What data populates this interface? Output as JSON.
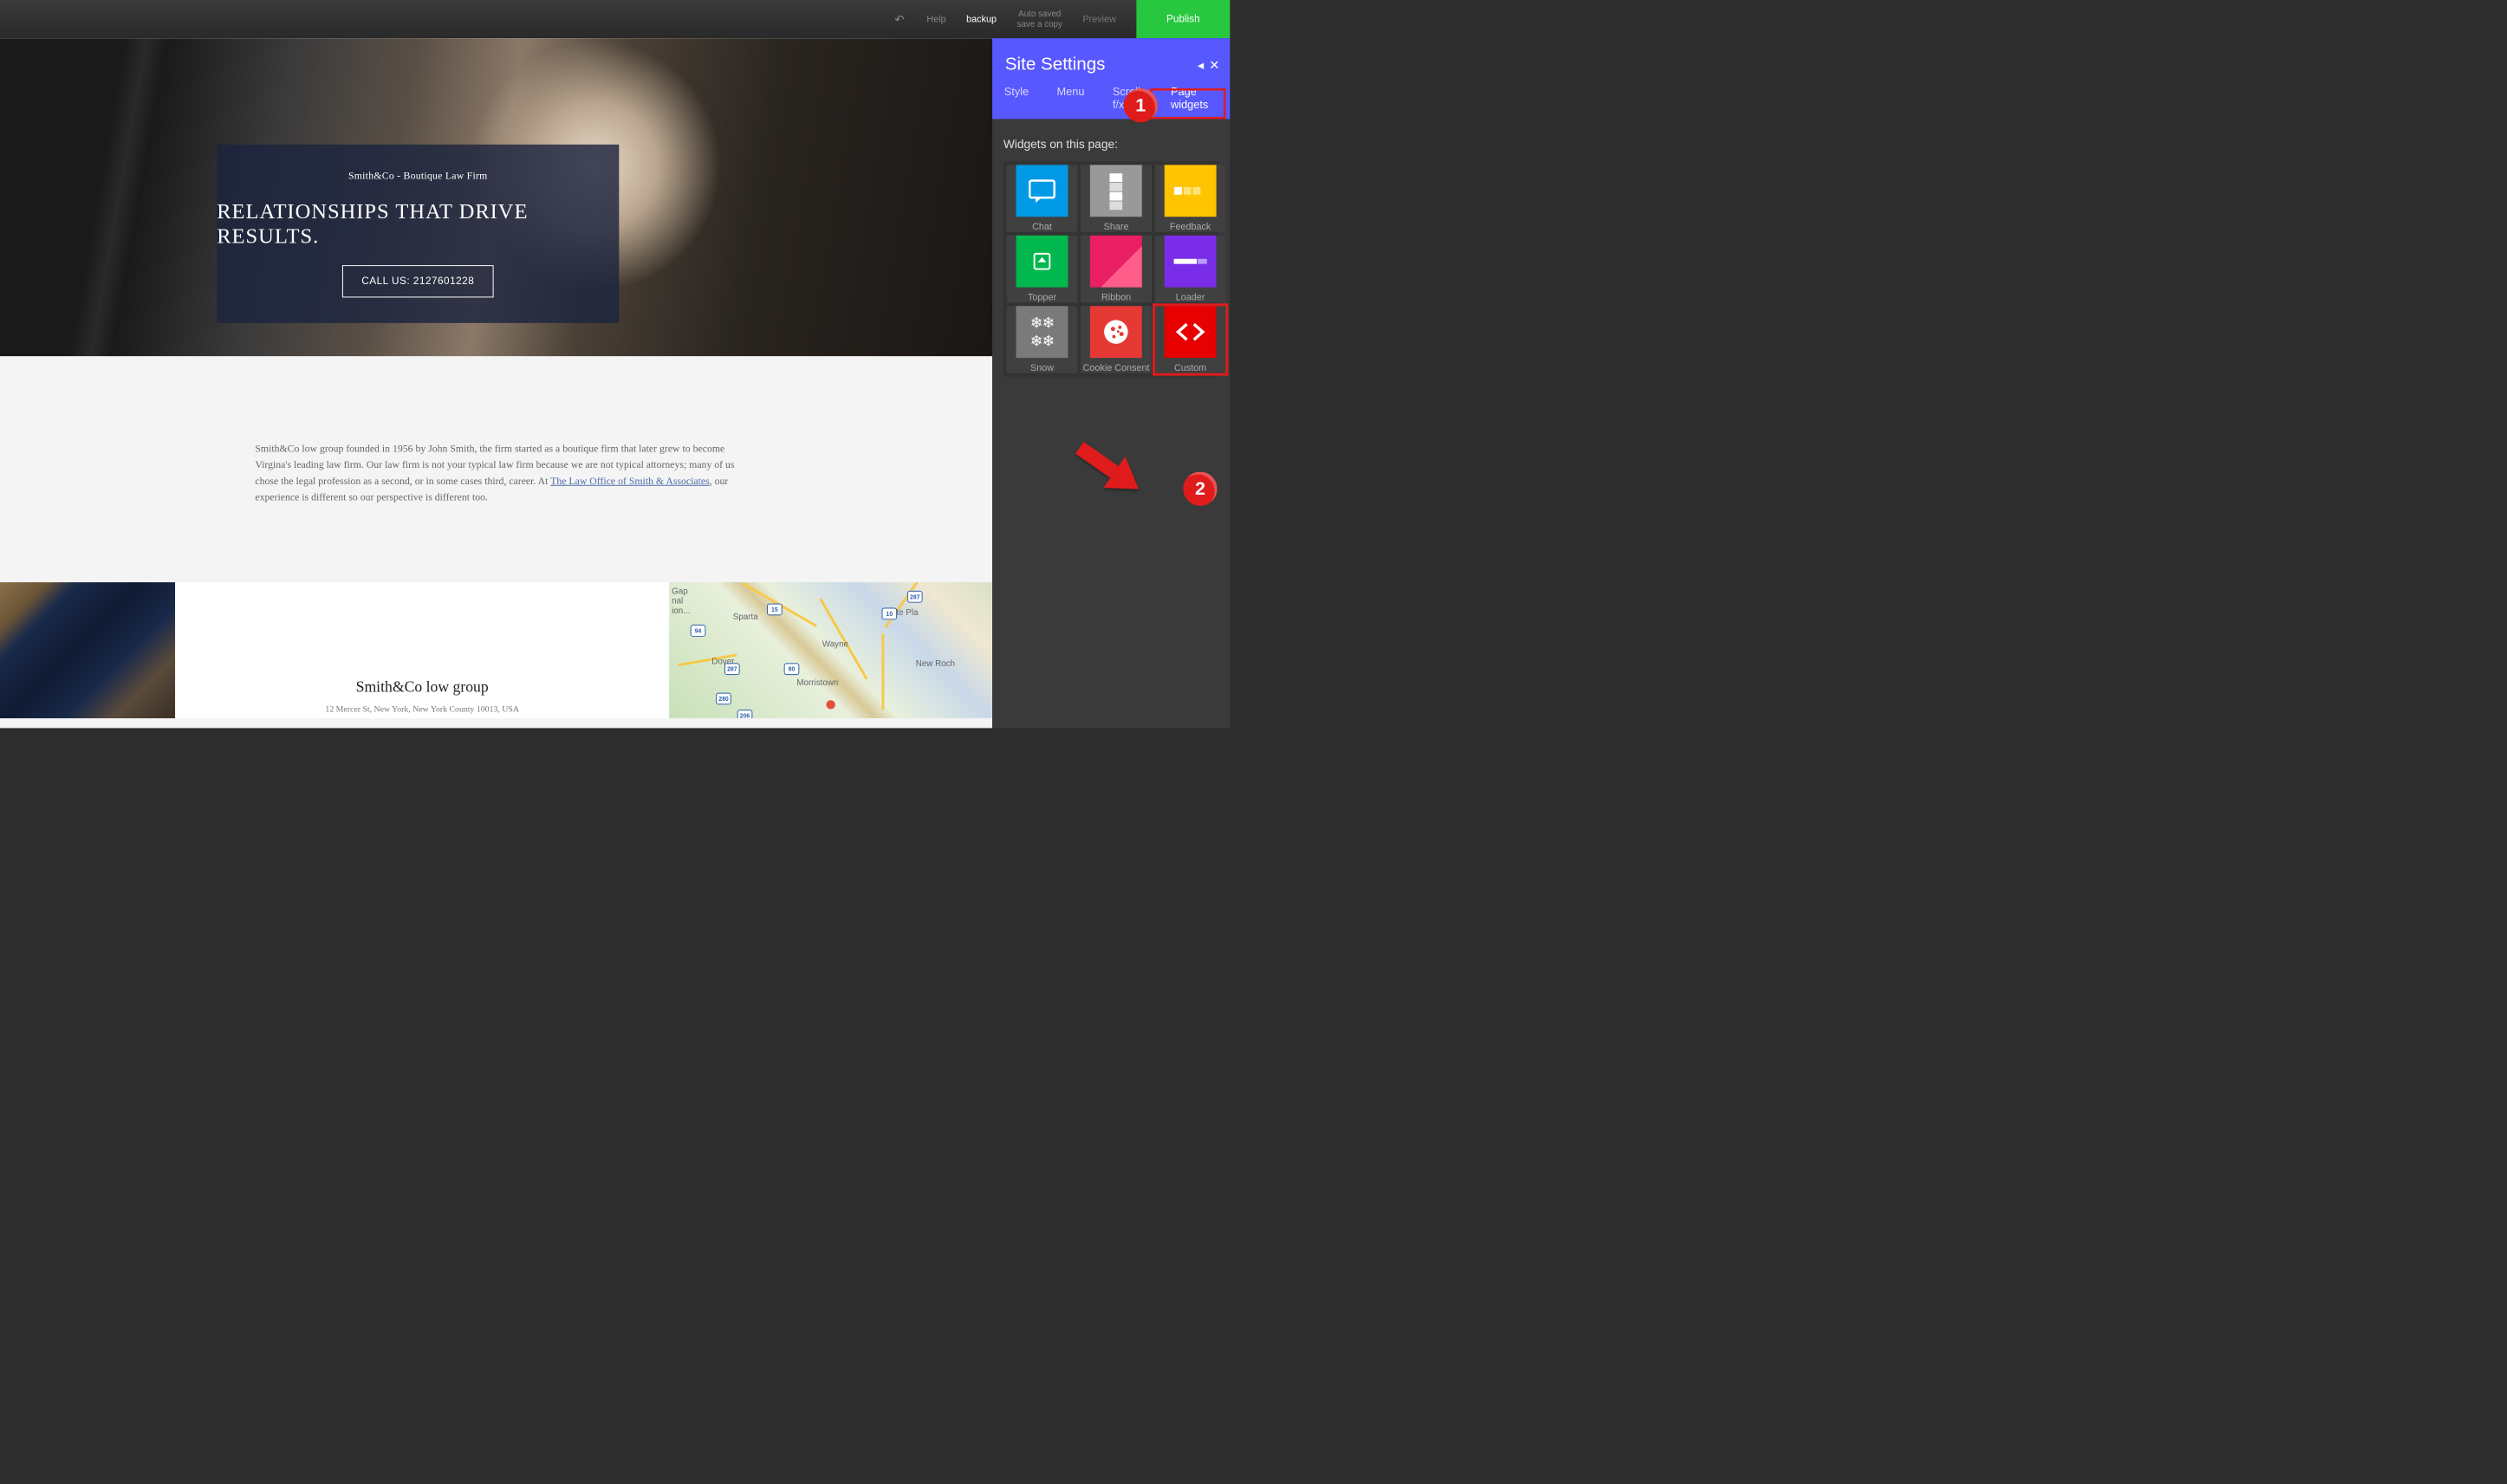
{
  "topbar": {
    "help": "Help",
    "backup": "backup",
    "autosaved_line1": "Auto saved",
    "autosaved_line2": "save a copy",
    "preview": "Preview",
    "publish": "Publish"
  },
  "hero": {
    "subtitle": "Smith&Co - Boutique Law Firm",
    "title": "RELATIONSHIPS THAT DRIVE RESULTS.",
    "cta": "CALL US: 2127601228"
  },
  "about": {
    "text_before_link": "Smith&Co low group founded in 1956 by John Smith, the firm started as a boutique firm that later grew to become Virgina's leading law firm. Our law firm is not your typical law firm because we are not typical attorneys; many of us chose the legal profession as a second, or in some cases third, career. At ",
    "link_text": "The Law Office of Smith & Associates",
    "text_after_link": ", our experience is different so our perspective is different too."
  },
  "contact": {
    "title": "Smith&Co low group",
    "address": "12 Mercer St, New York, New York County 10013, USA"
  },
  "map": {
    "labels": [
      "Sparta",
      "Dover",
      "Wayne",
      "Morristown",
      "White Pla",
      "New Roch"
    ],
    "partial_left": "Gap\nnal\nion...",
    "shields": [
      "94",
      "15",
      "287",
      "80",
      "280",
      "206",
      "10",
      "287"
    ]
  },
  "panel": {
    "title": "Site Settings",
    "tabs": [
      "Style",
      "Menu",
      "Scroll f/x",
      "Page widgets"
    ],
    "active_tab": 3,
    "widgets_heading": "Widgets on this page:",
    "widgets": [
      {
        "name": "Chat",
        "key": "chat"
      },
      {
        "name": "Share",
        "key": "share"
      },
      {
        "name": "Feedback",
        "key": "feedback"
      },
      {
        "name": "Topper",
        "key": "topper"
      },
      {
        "name": "Ribbon",
        "key": "ribbon"
      },
      {
        "name": "Loader",
        "key": "loader"
      },
      {
        "name": "Snow",
        "key": "snow"
      },
      {
        "name": "Cookie Consent",
        "key": "cookie"
      },
      {
        "name": "Custom",
        "key": "custom"
      }
    ]
  },
  "annotations": {
    "badge1": "1",
    "badge2": "2"
  }
}
